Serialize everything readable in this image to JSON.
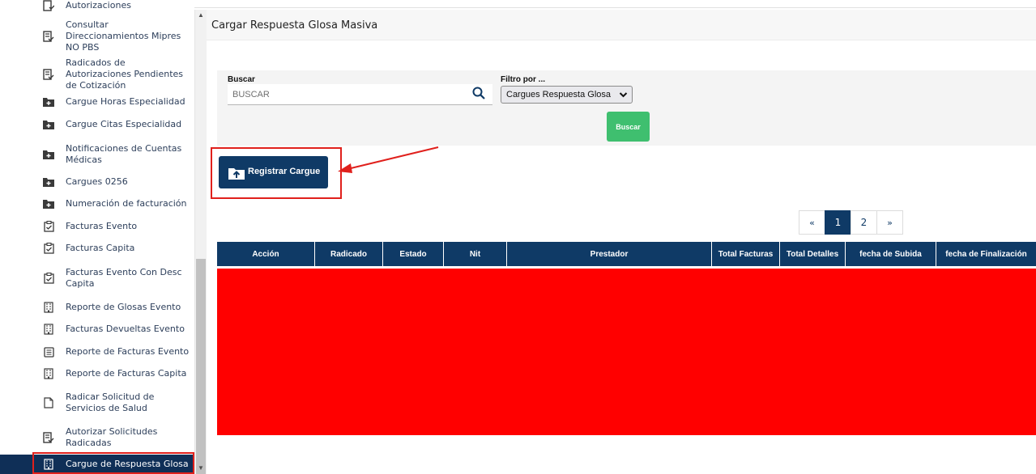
{
  "sidebar": {
    "top_partial_label": "Autorizaciones",
    "items": [
      {
        "label": "Consultar Direccionamientos Mipres NO PBS",
        "icon": "checklist-icon"
      },
      {
        "label": "Radicados de Autorizaciones Pendientes de Cotización",
        "icon": "checklist-icon"
      },
      {
        "label": "Cargue Horas Especialidad",
        "icon": "folder-plus-icon"
      },
      {
        "label": "Cargue Citas Especialidad",
        "icon": "folder-plus-icon"
      },
      {
        "label": "Notificaciones de Cuentas Médicas",
        "icon": "folder-plus-icon"
      },
      {
        "label": "Cargues 0256",
        "icon": "folder-plus-icon"
      },
      {
        "label": "Numeración de facturación",
        "icon": "folder-plus-icon"
      },
      {
        "label": "Facturas Evento",
        "icon": "clipboard-check-icon"
      },
      {
        "label": "Facturas Capita",
        "icon": "clipboard-check-icon"
      },
      {
        "label": "Facturas Evento Con Desc Capita",
        "icon": "clipboard-check-icon"
      },
      {
        "label": "Reporte de Glosas Evento",
        "icon": "building-icon"
      },
      {
        "label": "Facturas Devueltas Evento",
        "icon": "building-icon"
      },
      {
        "label": "Reporte de Facturas Evento",
        "icon": "list-doc-icon"
      },
      {
        "label": "Reporte de Facturas Capita",
        "icon": "building-icon"
      },
      {
        "label": "Radicar Solicitud de Servicios de Salud",
        "icon": "document-icon"
      },
      {
        "label": "Autorizar Solicitudes Radicadas",
        "icon": "checklist-icon"
      },
      {
        "label": "Cargue de Respuesta Glosa",
        "icon": "building-icon"
      }
    ]
  },
  "main": {
    "title": "Cargar Respuesta Glosa Masiva",
    "search": {
      "label": "Buscar",
      "placeholder": "BUSCAR"
    },
    "filter": {
      "label": "Filtro por ...",
      "selected": "Cargues Respuesta Glosa"
    },
    "buscar_button": "Buscar",
    "register_button": "Registrar Cargue",
    "pagination": {
      "prev": "«",
      "pages": [
        "1",
        "2"
      ],
      "next": "»",
      "current": "1"
    },
    "table": {
      "columns": [
        "Acción",
        "Radicado",
        "Estado",
        "Nit",
        "Prestador",
        "Total Facturas",
        "Total Detalles",
        "fecha de Subida",
        "fecha de Finalización"
      ]
    }
  },
  "colors": {
    "primary": "#0f3a66",
    "success": "#3fbf6f",
    "highlight": "#e0201c",
    "table_body": "#ff0000"
  }
}
